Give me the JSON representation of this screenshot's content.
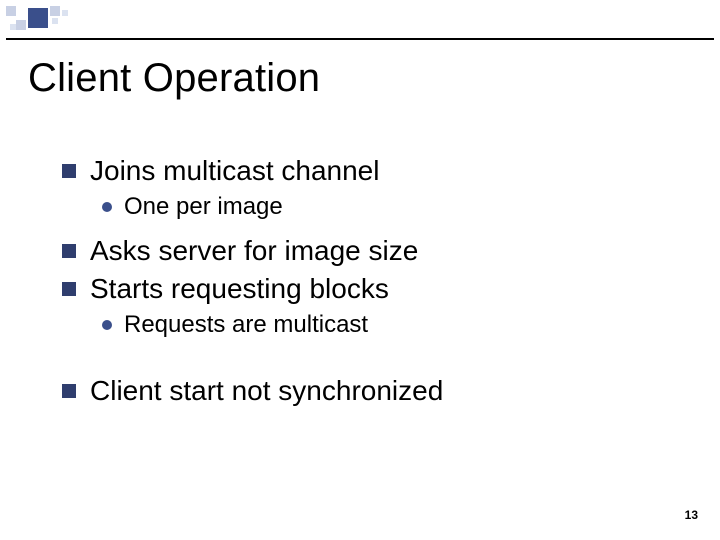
{
  "title": "Client Operation",
  "bullets": {
    "b1": "Joins multicast channel",
    "b1_sub1": "One per image",
    "b2": "Asks server for image size",
    "b3": "Starts requesting blocks",
    "b3_sub1": "Requests are multicast",
    "b4": "Client start not synchronized"
  },
  "page_number": "13"
}
